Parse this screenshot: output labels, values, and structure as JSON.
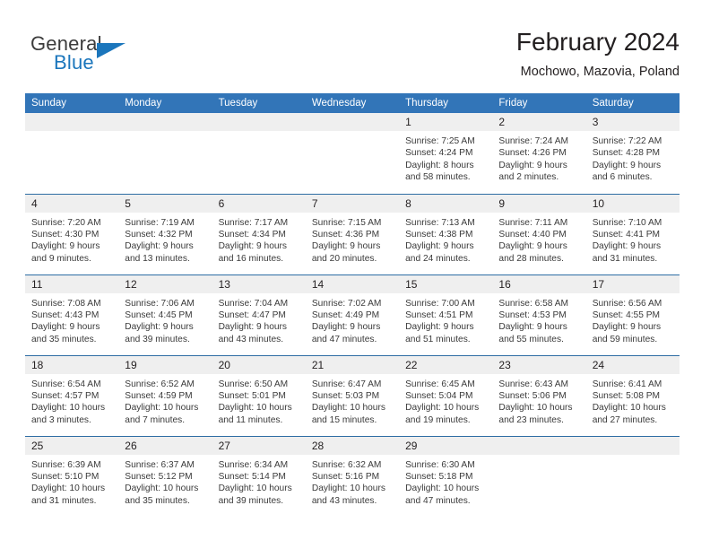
{
  "brand": {
    "name_top": "General",
    "name_bottom": "Blue",
    "triangle_color": "#1b76bc",
    "top_color": "#3c3c3c",
    "bottom_color": "#1b76bc"
  },
  "header": {
    "title": "February 2024",
    "location": "Mochowo, Mazovia, Poland"
  },
  "theme": {
    "header_blue": "#3275b8",
    "row_border_blue": "#2e6da4",
    "daynum_band": "#efefef",
    "text": "#231f20"
  },
  "weekday_headers": [
    "Sunday",
    "Monday",
    "Tuesday",
    "Wednesday",
    "Thursday",
    "Friday",
    "Saturday"
  ],
  "weeks": [
    [
      {
        "day": "",
        "lines": []
      },
      {
        "day": "",
        "lines": []
      },
      {
        "day": "",
        "lines": []
      },
      {
        "day": "",
        "lines": []
      },
      {
        "day": "1",
        "lines": [
          "Sunrise: 7:25 AM",
          "Sunset: 4:24 PM",
          "Daylight: 8 hours",
          "and 58 minutes."
        ]
      },
      {
        "day": "2",
        "lines": [
          "Sunrise: 7:24 AM",
          "Sunset: 4:26 PM",
          "Daylight: 9 hours",
          "and 2 minutes."
        ]
      },
      {
        "day": "3",
        "lines": [
          "Sunrise: 7:22 AM",
          "Sunset: 4:28 PM",
          "Daylight: 9 hours",
          "and 6 minutes."
        ]
      }
    ],
    [
      {
        "day": "4",
        "lines": [
          "Sunrise: 7:20 AM",
          "Sunset: 4:30 PM",
          "Daylight: 9 hours",
          "and 9 minutes."
        ]
      },
      {
        "day": "5",
        "lines": [
          "Sunrise: 7:19 AM",
          "Sunset: 4:32 PM",
          "Daylight: 9 hours",
          "and 13 minutes."
        ]
      },
      {
        "day": "6",
        "lines": [
          "Sunrise: 7:17 AM",
          "Sunset: 4:34 PM",
          "Daylight: 9 hours",
          "and 16 minutes."
        ]
      },
      {
        "day": "7",
        "lines": [
          "Sunrise: 7:15 AM",
          "Sunset: 4:36 PM",
          "Daylight: 9 hours",
          "and 20 minutes."
        ]
      },
      {
        "day": "8",
        "lines": [
          "Sunrise: 7:13 AM",
          "Sunset: 4:38 PM",
          "Daylight: 9 hours",
          "and 24 minutes."
        ]
      },
      {
        "day": "9",
        "lines": [
          "Sunrise: 7:11 AM",
          "Sunset: 4:40 PM",
          "Daylight: 9 hours",
          "and 28 minutes."
        ]
      },
      {
        "day": "10",
        "lines": [
          "Sunrise: 7:10 AM",
          "Sunset: 4:41 PM",
          "Daylight: 9 hours",
          "and 31 minutes."
        ]
      }
    ],
    [
      {
        "day": "11",
        "lines": [
          "Sunrise: 7:08 AM",
          "Sunset: 4:43 PM",
          "Daylight: 9 hours",
          "and 35 minutes."
        ]
      },
      {
        "day": "12",
        "lines": [
          "Sunrise: 7:06 AM",
          "Sunset: 4:45 PM",
          "Daylight: 9 hours",
          "and 39 minutes."
        ]
      },
      {
        "day": "13",
        "lines": [
          "Sunrise: 7:04 AM",
          "Sunset: 4:47 PM",
          "Daylight: 9 hours",
          "and 43 minutes."
        ]
      },
      {
        "day": "14",
        "lines": [
          "Sunrise: 7:02 AM",
          "Sunset: 4:49 PM",
          "Daylight: 9 hours",
          "and 47 minutes."
        ]
      },
      {
        "day": "15",
        "lines": [
          "Sunrise: 7:00 AM",
          "Sunset: 4:51 PM",
          "Daylight: 9 hours",
          "and 51 minutes."
        ]
      },
      {
        "day": "16",
        "lines": [
          "Sunrise: 6:58 AM",
          "Sunset: 4:53 PM",
          "Daylight: 9 hours",
          "and 55 minutes."
        ]
      },
      {
        "day": "17",
        "lines": [
          "Sunrise: 6:56 AM",
          "Sunset: 4:55 PM",
          "Daylight: 9 hours",
          "and 59 minutes."
        ]
      }
    ],
    [
      {
        "day": "18",
        "lines": [
          "Sunrise: 6:54 AM",
          "Sunset: 4:57 PM",
          "Daylight: 10 hours",
          "and 3 minutes."
        ]
      },
      {
        "day": "19",
        "lines": [
          "Sunrise: 6:52 AM",
          "Sunset: 4:59 PM",
          "Daylight: 10 hours",
          "and 7 minutes."
        ]
      },
      {
        "day": "20",
        "lines": [
          "Sunrise: 6:50 AM",
          "Sunset: 5:01 PM",
          "Daylight: 10 hours",
          "and 11 minutes."
        ]
      },
      {
        "day": "21",
        "lines": [
          "Sunrise: 6:47 AM",
          "Sunset: 5:03 PM",
          "Daylight: 10 hours",
          "and 15 minutes."
        ]
      },
      {
        "day": "22",
        "lines": [
          "Sunrise: 6:45 AM",
          "Sunset: 5:04 PM",
          "Daylight: 10 hours",
          "and 19 minutes."
        ]
      },
      {
        "day": "23",
        "lines": [
          "Sunrise: 6:43 AM",
          "Sunset: 5:06 PM",
          "Daylight: 10 hours",
          "and 23 minutes."
        ]
      },
      {
        "day": "24",
        "lines": [
          "Sunrise: 6:41 AM",
          "Sunset: 5:08 PM",
          "Daylight: 10 hours",
          "and 27 minutes."
        ]
      }
    ],
    [
      {
        "day": "25",
        "lines": [
          "Sunrise: 6:39 AM",
          "Sunset: 5:10 PM",
          "Daylight: 10 hours",
          "and 31 minutes."
        ]
      },
      {
        "day": "26",
        "lines": [
          "Sunrise: 6:37 AM",
          "Sunset: 5:12 PM",
          "Daylight: 10 hours",
          "and 35 minutes."
        ]
      },
      {
        "day": "27",
        "lines": [
          "Sunrise: 6:34 AM",
          "Sunset: 5:14 PM",
          "Daylight: 10 hours",
          "and 39 minutes."
        ]
      },
      {
        "day": "28",
        "lines": [
          "Sunrise: 6:32 AM",
          "Sunset: 5:16 PM",
          "Daylight: 10 hours",
          "and 43 minutes."
        ]
      },
      {
        "day": "29",
        "lines": [
          "Sunrise: 6:30 AM",
          "Sunset: 5:18 PM",
          "Daylight: 10 hours",
          "and 47 minutes."
        ]
      },
      {
        "day": "",
        "lines": []
      },
      {
        "day": "",
        "lines": []
      }
    ]
  ]
}
